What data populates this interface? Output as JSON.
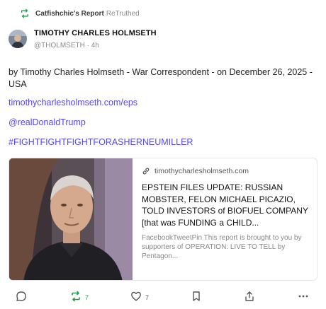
{
  "retruth_header": {
    "user": "Catfishchic's Report",
    "suffix": "ReTruthed"
  },
  "author": {
    "name": "TIMOTHY CHARLES HOLMSETH",
    "meta": "@THOLMSETH · 4h"
  },
  "post": {
    "text": "by Timothy Charles Holmseth - War Correspondent - on December 26, 2025 - USA",
    "links": [
      "timothycharlesholmseth.com/eps",
      "@realDonaldTrump",
      "#FIGHTFIGHTFIGHTFORASHERNEUMILLER"
    ]
  },
  "card": {
    "domain": "timothycharlesholmseth.com",
    "title": "EPSTEIN FILES UPDATE: RUSSIAN MOBSTER, FELON MICHAEL PICAZIO, TOLD INVESTORS of BIOFUEL COMPANY [that was FUNDING a CHILD...",
    "description": "FacebookTweetPin This report is brought to you by supporters of OPERATION: LIVE TO TELL by Pentagon..."
  },
  "actions": {
    "retruth_count": "7",
    "like_count": "7"
  },
  "colors": {
    "link": "#5448ee",
    "retruth_green": "#1f9d4f",
    "muted": "#8a8a8a"
  },
  "icons": [
    "retruth-icon",
    "link-icon",
    "reply-icon",
    "like-icon",
    "bookmark-icon",
    "share-icon",
    "more-icon"
  ]
}
